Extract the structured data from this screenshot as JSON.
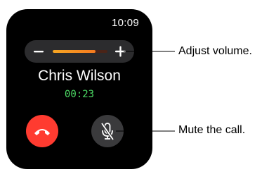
{
  "status": {
    "time": "10:09"
  },
  "volume": {
    "level": 0.78,
    "fill_color": "#f5a623",
    "minus_icon": "minus-icon",
    "plus_icon": "plus-icon"
  },
  "call": {
    "caller_name": "Chris Wilson",
    "duration": "00:23"
  },
  "buttons": {
    "end_call": {
      "icon": "phone-hangup-icon",
      "color": "#ff3b30"
    },
    "mute": {
      "icon": "microphone-muted-icon",
      "color": "#3a3a3c"
    }
  },
  "callouts": {
    "volume": "Adjust volume.",
    "mute": "Mute the call."
  }
}
